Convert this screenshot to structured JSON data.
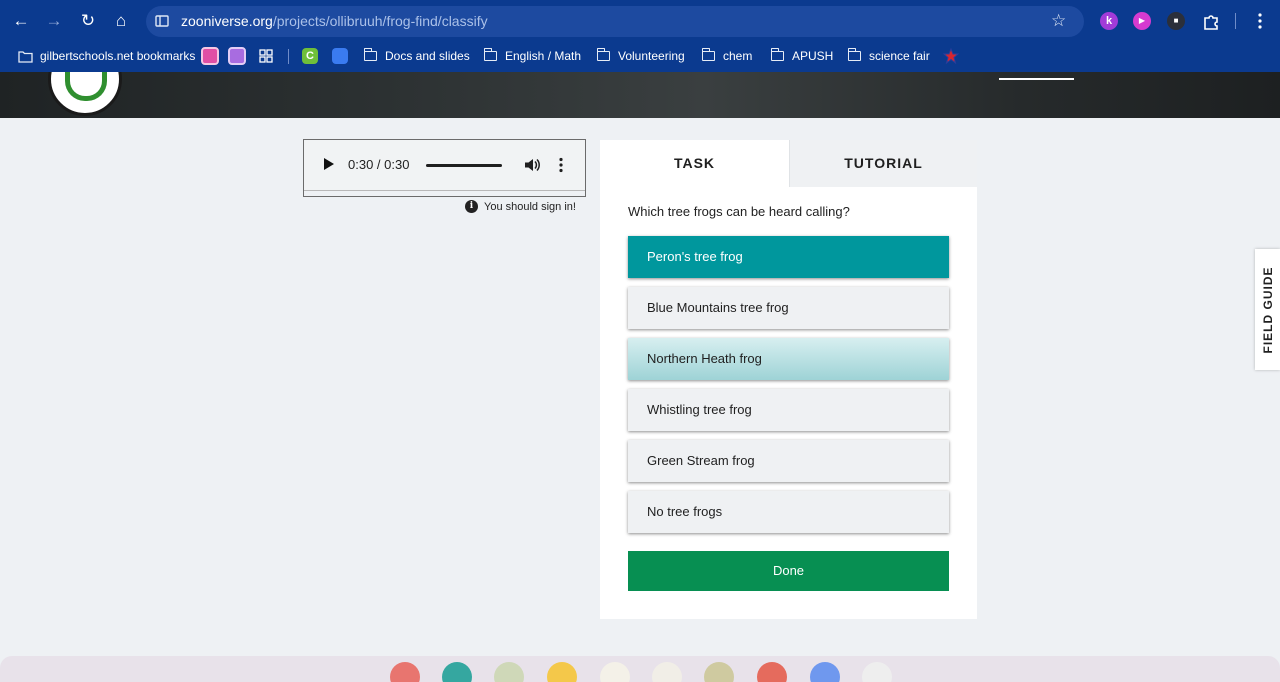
{
  "browser": {
    "url_host": "zooniverse.org",
    "url_path": "/projects/ollibruuh/frog-find/classify",
    "nav_icons": [
      "back-arrow-icon",
      "forward-arrow-icon",
      "reload-icon",
      "home-icon"
    ],
    "extensions": [
      {
        "name": "kami-extension-icon",
        "glyph": "k",
        "color": "#a23bd8"
      },
      {
        "name": "screencast-extension-icon",
        "glyph": "▶",
        "color": "#d63bd0"
      },
      {
        "name": "extension-app-icon",
        "glyph": "■",
        "color": "#2b2f3a"
      }
    ]
  },
  "bookmarks": {
    "items": [
      {
        "label": "gilbertschools.net bookmarks",
        "type": "managed"
      },
      {
        "label": "Docs and slides",
        "type": "folder"
      },
      {
        "label": "English / Math",
        "type": "folder"
      },
      {
        "label": "Volunteering",
        "type": "folder"
      },
      {
        "label": "chem",
        "type": "folder"
      },
      {
        "label": "APUSH",
        "type": "folder"
      },
      {
        "label": "science fair",
        "type": "folder"
      }
    ]
  },
  "audio": {
    "time": "0:30 / 0:30",
    "progress_fraction": 1.0
  },
  "notice": {
    "text": "You should sign in!"
  },
  "task": {
    "tabs": [
      "TASK",
      "TUTORIAL"
    ],
    "question": "Which tree frogs can be heard calling?",
    "answers": [
      {
        "label": "Peron's tree frog",
        "state": "selected"
      },
      {
        "label": "Blue Mountains tree frog",
        "state": "default"
      },
      {
        "label": "Northern Heath frog",
        "state": "hover"
      },
      {
        "label": "Whistling tree frog",
        "state": "default"
      },
      {
        "label": "Green Stream frog",
        "state": "default"
      },
      {
        "label": "No tree frogs",
        "state": "default"
      }
    ],
    "done_label": "Done"
  },
  "field_guide": {
    "label": "FIELD GUIDE"
  },
  "colors": {
    "browser_chrome": "#0b3a8f",
    "selected_answer": "#00979d",
    "done_button": "#078f52"
  },
  "shelf_apps": [
    "canvas-icon",
    "classroom-icon",
    "keep-icon",
    "drive-icon",
    "gmail-icon",
    "files-icon",
    "chrome-icon",
    "docs-icon",
    "play-store-icon"
  ]
}
